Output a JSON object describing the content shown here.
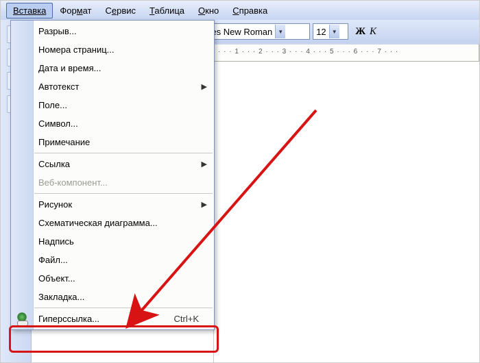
{
  "menubar": {
    "insert": "Вставка",
    "format": "Формат",
    "service": "Сервис",
    "table": "Таблица",
    "window": "Окно",
    "help": "Справка"
  },
  "toolbar": {
    "font_name": "Times New Roman",
    "font_size": "12",
    "bold": "Ж",
    "italic": "К"
  },
  "ruler": "· · · 1 · · · 2 · · · 3 · · · 4 · · · 5 · · · 6 · · · 7 · · ·",
  "menu": {
    "break": "Разрыв...",
    "page_numbers": "Номера страниц...",
    "date_time": "Дата и время...",
    "autotext": "Автотекст",
    "field": "Поле...",
    "symbol": "Символ...",
    "comment": "Примечание",
    "reference": "Ссылка",
    "web_component": "Веб-компонент...",
    "picture": "Рисунок",
    "diagram": "Схематическая диаграмма...",
    "textbox": "Надпись",
    "file": "Файл...",
    "object": "Объект...",
    "bookmark": "Закладка...",
    "hyperlink": "Гиперссылка...",
    "hyperlink_shortcut": "Ctrl+K"
  }
}
